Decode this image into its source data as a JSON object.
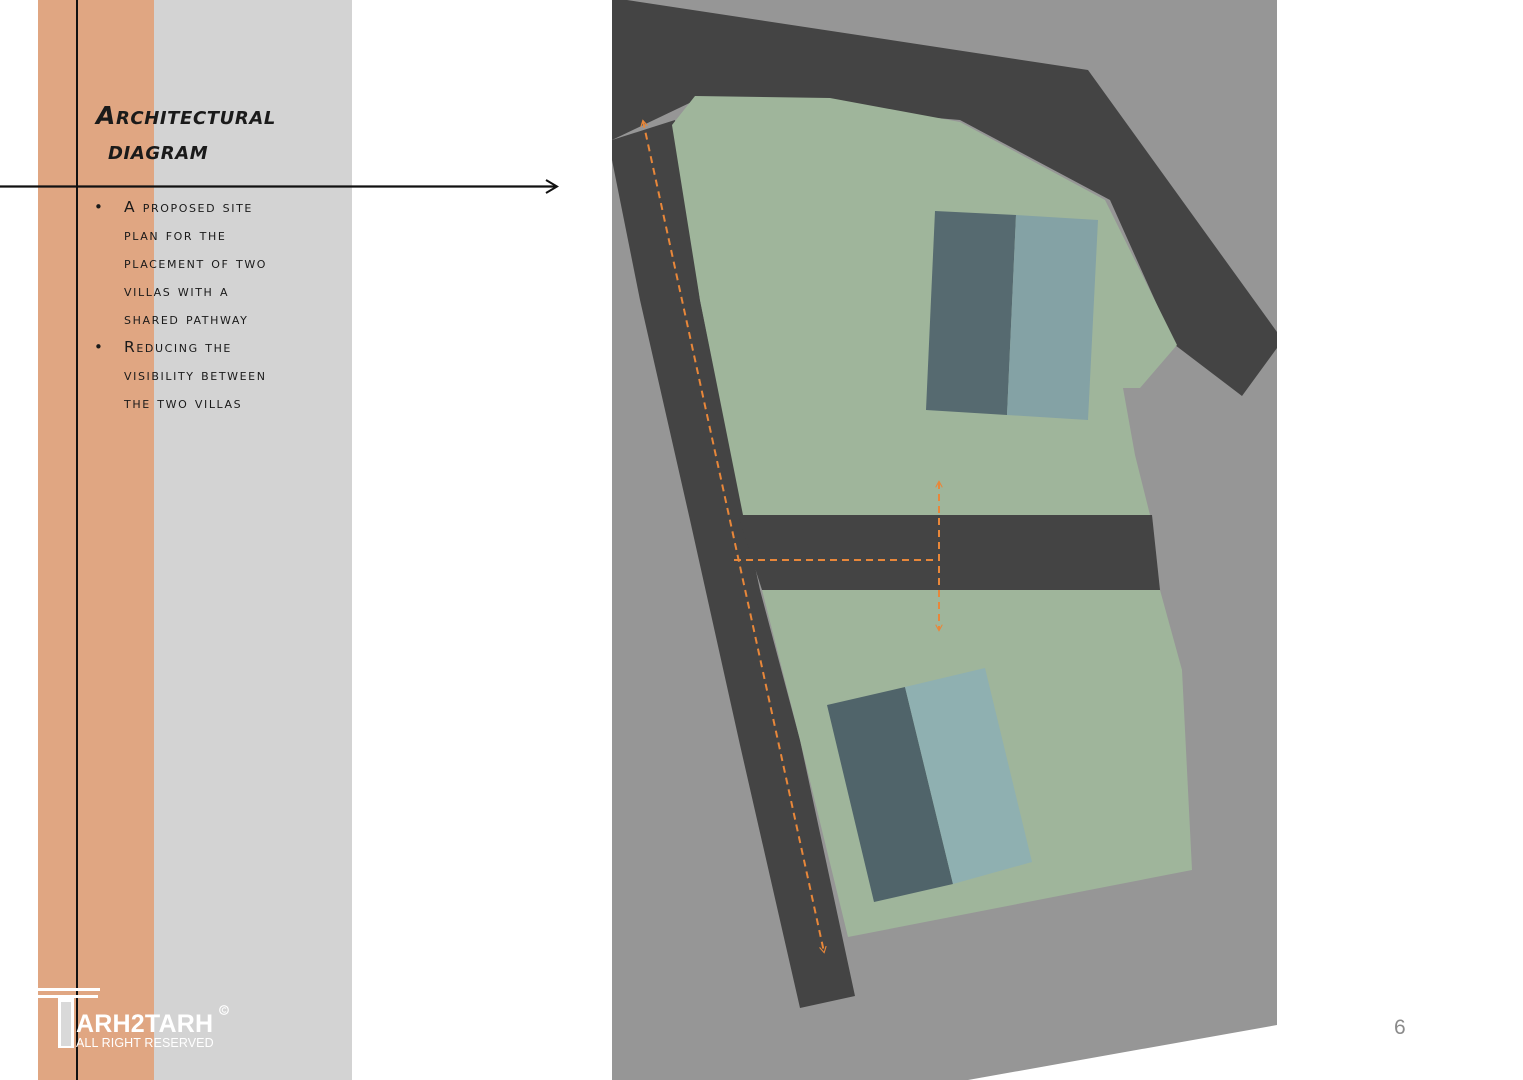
{
  "slide": {
    "title_line1": "Architectural",
    "title_line2": "diagram",
    "bullets": [
      [
        "A proposed site",
        "plan for the",
        "placement of two",
        "villas with a",
        "shared pathway"
      ],
      [
        "Reducing the",
        "visibility between",
        "the two villas"
      ]
    ],
    "bullet_symbol": "•",
    "page_number": "6"
  },
  "logo": {
    "name": "ARH2TARH",
    "copyright_symbol": "©",
    "tagline": "ALL RIGHT RESERVED"
  },
  "colors": {
    "accent_orange": "#e0a682",
    "sidebar_grey": "#d3d3d3",
    "site_background": "#969696",
    "road": "#444444",
    "lawn": "#9fb59b",
    "villa_dark": "#566a70",
    "villa_light": "#84a2a5",
    "path_arrow": "#e8873a"
  }
}
